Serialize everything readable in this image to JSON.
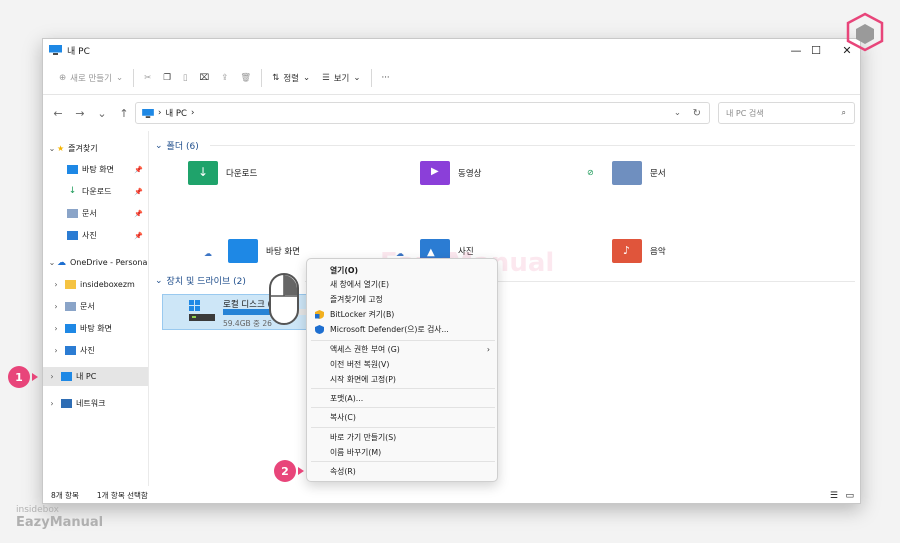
{
  "window": {
    "title": "내 PC"
  },
  "toolbar": {
    "new_label": "새로 만들기",
    "sort_label": "정렬",
    "view_label": "보기",
    "more": "···"
  },
  "address": {
    "path_sep1": "›",
    "path": "내 PC",
    "path_sep2": "›",
    "search_placeholder": "내 PC 검색"
  },
  "sidebar": {
    "favorites": "즐겨찾기",
    "fav_items": [
      "바탕 화면",
      "다운로드",
      "문서",
      "사진"
    ],
    "onedrive": "OneDrive - Persona",
    "od_items": [
      "insideboxezm",
      "문서",
      "바탕 화면",
      "사진"
    ],
    "thispc": "내 PC",
    "network": "네트워크"
  },
  "main": {
    "folders_header": "폴더 (6)",
    "folders": [
      "다운로드",
      "동영상",
      "문서",
      "바탕 화면",
      "사진",
      "음악"
    ],
    "devices_header": "장치 및 드라이브 (2)",
    "drive": {
      "name": "로컬 디스크 (C:)",
      "size": "59.4GB 중 26",
      "used_fraction": 0.56
    }
  },
  "context_menu": {
    "items": [
      "열기(O)",
      "새 창에서 열기(E)",
      "즐겨찾기에 고정",
      "BitLocker 켜기(B)",
      "Microsoft Defender(으)로 검사...",
      "액세스 권한 부여 (G)",
      "이전 버전 복원(V)",
      "시작 화면에 고정(P)",
      "포맷(A)...",
      "복사(C)",
      "바로 가기 만들기(S)",
      "이름 바꾸기(M)",
      "속성(R)"
    ]
  },
  "status": {
    "count": "8개 항목",
    "selected": "1개 항목 선택함"
  },
  "badges": {
    "one": "1",
    "two": "2"
  },
  "watermark": {
    "small": "insidebox",
    "big": "EazyManual"
  },
  "colors": {
    "accent": "#2683d6",
    "badge": "#e8457a",
    "selection": "#cde6f7"
  }
}
